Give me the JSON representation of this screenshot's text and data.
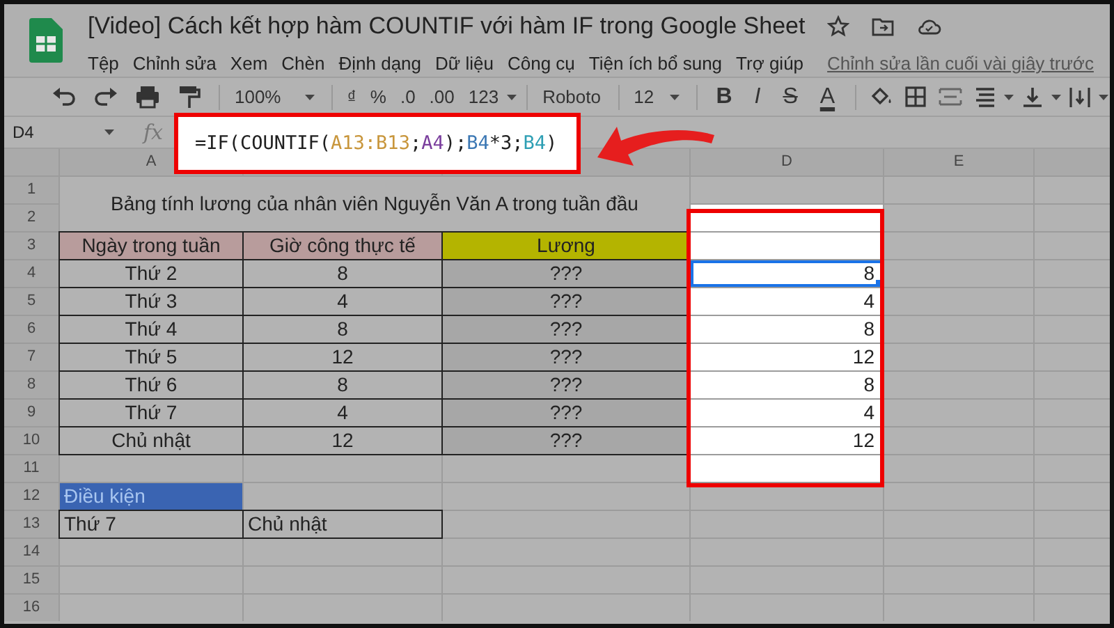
{
  "document": {
    "title": "[Video] Cách kết hợp hàm COUNTIF với hàm IF trong Google Sheet"
  },
  "menu": [
    "Tệp",
    "Chỉnh sửa",
    "Xem",
    "Chèn",
    "Định dạng",
    "Dữ liệu",
    "Công cụ",
    "Tiện ích bổ sung",
    "Trợ giúp"
  ],
  "last_edit": "Chỉnh sửa lần cuối vài giây trước",
  "toolbar": {
    "zoom": "100%",
    "format_buttons": [
      "₫",
      "%",
      ".0",
      ".00",
      "123"
    ],
    "font": "Roboto",
    "font_size": "12",
    "text_styles": [
      "B",
      "I",
      "S",
      "A"
    ]
  },
  "formula_bar": {
    "cell_ref": "D4",
    "fx": "fx",
    "formula": [
      {
        "text": "=IF(COUNTIF(",
        "color": "#202020"
      },
      {
        "text": "A13:B13",
        "color": "#c8963c"
      },
      {
        "text": ";",
        "color": "#202020"
      },
      {
        "text": "A4",
        "color": "#7a3e9d"
      },
      {
        "text": ");",
        "color": "#202020"
      },
      {
        "text": "B4",
        "color": "#3c78b4"
      },
      {
        "text": "*3;",
        "color": "#202020"
      },
      {
        "text": "B4",
        "color": "#2e9fb4"
      },
      {
        "text": ")",
        "color": "#202020"
      }
    ]
  },
  "columns": [
    {
      "label": "A"
    },
    {},
    {},
    {
      "label": "D"
    },
    {
      "label": "E"
    }
  ],
  "row_numbers": [
    "1",
    "2",
    "3",
    "4",
    "5",
    "6",
    "7",
    "8",
    "9",
    "10",
    "11",
    "12",
    "13",
    "14",
    "15",
    "16"
  ],
  "sheet": {
    "title": "Bảng tính lương của nhân viên Nguyễn Văn A trong tuần đầu",
    "headers": [
      {
        "text": "Ngày trong tuần",
        "color": "#b89c9c"
      },
      {
        "text": "Giờ công thực tế",
        "color": "#b89c9c"
      },
      {
        "text": "Lương",
        "color": "#b4b400"
      }
    ],
    "rows": [
      {
        "day": "Thứ 2",
        "hours": "8",
        "salary": "???",
        "result": "8",
        "selected": true
      },
      {
        "day": "Thứ 3",
        "hours": "4",
        "salary": "???",
        "result": "4",
        "selected": false
      },
      {
        "day": "Thứ 4",
        "hours": "8",
        "salary": "???",
        "result": "8",
        "selected": false
      },
      {
        "day": "Thứ 5",
        "hours": "12",
        "salary": "???",
        "result": "12",
        "selected": false
      },
      {
        "day": "Thứ 6",
        "hours": "8",
        "salary": "???",
        "result": "8",
        "selected": false
      },
      {
        "day": "Thứ 7",
        "hours": "4",
        "salary": "???",
        "result": "4",
        "selected": false
      },
      {
        "day": "Chủ nhật",
        "hours": "12",
        "salary": "???",
        "result": "12",
        "selected": false
      }
    ],
    "condition": {
      "label": "Điều kiện",
      "values": [
        "Thứ 7",
        "Chủ nhật"
      ]
    }
  }
}
